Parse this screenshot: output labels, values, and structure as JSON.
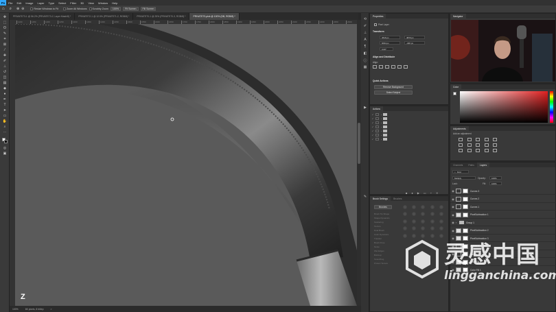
{
  "app": {
    "name": "Photoshop",
    "logo_text": "Ps"
  },
  "menubar": {
    "items": [
      "File",
      "Edit",
      "Image",
      "Layer",
      "Type",
      "Select",
      "Filter",
      "3D",
      "View",
      "Window",
      "Help"
    ]
  },
  "options_bar": {
    "resize_windows": "Resize Windows to Fit",
    "zoom_all_windows": "Zoom All Windows",
    "scrubby_zoom": "Scrubby Zoom",
    "zoom_value": "100%",
    "fit_screen": "Fit Screen",
    "fill_screen": "Fill Screen"
  },
  "doc_tabs": [
    {
      "label": "PRIVATE73-1 @ 56.2% (PRIVATE73-2, Layer Mask/8) *",
      "active": false
    },
    {
      "label": "PRIVATE72-1 @ 12.5% (PRIVATE71-2, RGB/8) *",
      "active": false
    },
    {
      "label": "PRIVATE70-1 @ 25% (PRIVATE70-3, RGB/8) *",
      "active": false
    },
    {
      "label": "PRIVATE70-pick @ 100% (DB, RGB/8) *",
      "active": true
    }
  ],
  "ruler_top_ticks": [
    "1100",
    "1150",
    "1200",
    "1250",
    "1300",
    "1350",
    "1400",
    "1450",
    "1500",
    "1550",
    "1600",
    "1650",
    "1700",
    "1750",
    "1800",
    "1850",
    "1900",
    "1950",
    "2000",
    "2050",
    "2100",
    "2150",
    "2200",
    "2250",
    "2300"
  ],
  "status_bar": {
    "zoom": "100%",
    "doc_info": "6K pixels, 8 bit/ep",
    "arrow": ">"
  },
  "canvas": {
    "badge": "Z",
    "badge_color": "#ffffff",
    "background_color": "#595959"
  },
  "properties": {
    "title": "Properties",
    "layer_type": "Pixel Layer",
    "transform_title": "Transform",
    "w": "4516 px",
    "h": "6094 px",
    "x": "4870 px",
    "y": "-400 px",
    "angle": "0.00°",
    "align_title": "Align and Distribute",
    "align_sub": "Align:",
    "quick_actions_title": "Quick Actions",
    "remove_background": "Remove Background",
    "select_subject": "Select Subject"
  },
  "actions": {
    "title": "Actions",
    "rows": 7
  },
  "brush_settings": {
    "title": "Brush Settings",
    "tab2": "Brushes",
    "button": "Brushes",
    "items": [
      "Brush Tip Shape",
      "Shape Dynamics",
      "Scattering",
      "Texture",
      "Dual Brush",
      "Color Dynamics",
      "Transfer",
      "Brush Pose",
      "Noise",
      "Wet Edges",
      "Build-up",
      "Smoothing",
      "Protect Texture"
    ]
  },
  "navigator": {
    "title": "Navigator"
  },
  "color": {
    "title": "Color",
    "accent": "#e02020"
  },
  "adjustments": {
    "title": "Adjustments",
    "subtitle": "Add an adjustment"
  },
  "layers_panel": {
    "tabs": [
      "Channels",
      "Paths",
      "Layers"
    ],
    "active_tab": "Layers",
    "filter_label": "Kind",
    "blend_mode": "Multiply",
    "opacity_label": "Opacity:",
    "opacity_value": "100%",
    "fill_label": "Fill:",
    "fill_value": "100%",
    "lock_label": "Lock:",
    "layers": [
      {
        "name": "Curves 3",
        "type": "adjustment"
      },
      {
        "name": "Curves 2",
        "type": "adjustment"
      },
      {
        "name": "Curves 1",
        "type": "adjustment"
      },
      {
        "name": "PixelSubtraction 1",
        "type": "pixel"
      },
      {
        "name": "Group 1",
        "type": "group"
      },
      {
        "name": "PixelSubtraction 2",
        "type": "pixel"
      },
      {
        "name": "PixelSubtraction 3",
        "type": "pixel"
      },
      {
        "name": "Curves 4",
        "type": "adjustment"
      },
      {
        "name": "Curves 5",
        "type": "adjustment"
      },
      {
        "name": "Color Fill 1",
        "type": "fill"
      },
      {
        "name": "Color Fill 1",
        "type": "fill"
      }
    ]
  },
  "watermark": {
    "cn": "灵感中国",
    "en": "lingganchina.com"
  }
}
